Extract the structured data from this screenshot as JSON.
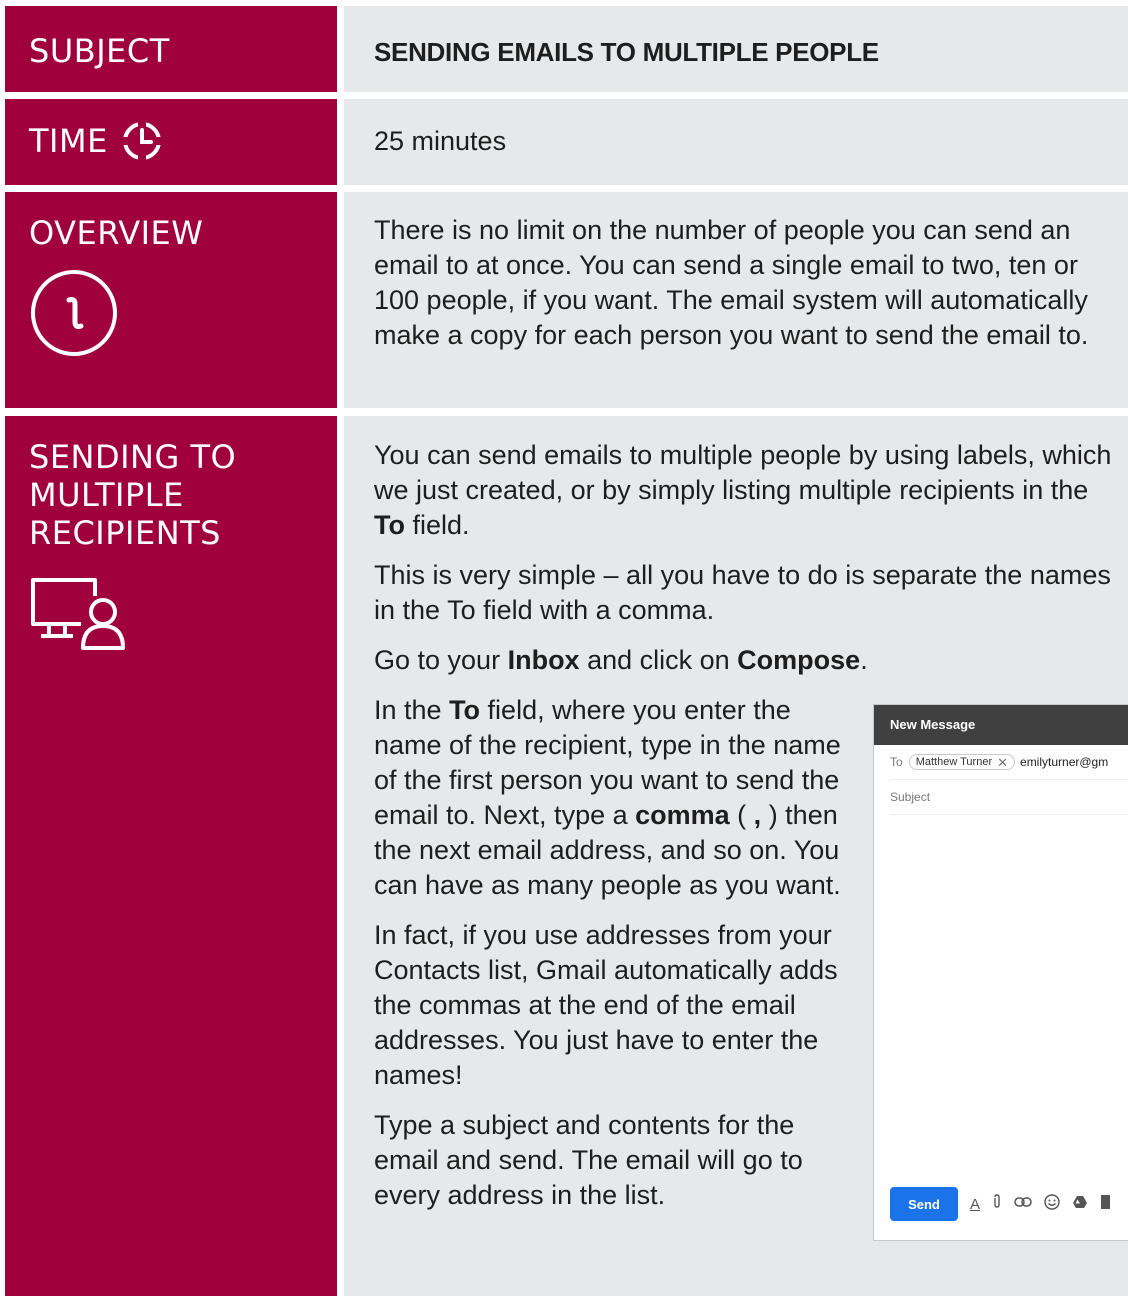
{
  "rows": {
    "subject": {
      "label": "SUBJECT",
      "value": "SENDING EMAILS TO MULTIPLE PEOPLE"
    },
    "time": {
      "label": "TIME",
      "icon": "clock-icon",
      "value": "25 minutes"
    },
    "overview": {
      "label": "OVERVIEW",
      "icon": "info-icon",
      "text": "There is no limit on the number of people you can send an email to at once. You can send a single email to two, ten or 100 people, if you want. The email system will automatically make a copy for each person you want to send the email to."
    },
    "sending": {
      "label_lines": [
        "SENDING TO",
        "MULTIPLE",
        "RECIPIENTS"
      ],
      "icon": "computer-person-icon",
      "p1_a": "You can send emails to multiple people by using labels, which we just created, or by simply listing multiple recipients in the ",
      "p1_b": "To",
      "p1_c": " field.",
      "p2": "This is very simple – all you have to do is separate the names in the To field with a comma.",
      "p3_a": "Go to your ",
      "p3_b": "Inbox",
      "p3_c": " and click on ",
      "p3_d": "Compose",
      "p3_e": ".",
      "p4_a": "In the ",
      "p4_b": "To",
      "p4_c": " field, where you enter the name of the recipient, type in the name of the first person you want to send the email to. Next, type a ",
      "p4_d": "comma",
      "p4_e": " ( ",
      "p4_f": ",",
      "p4_g": " ) then the next email address, and so on. You can have as many people as you want.",
      "p5": "In fact, if you use addresses from your Contacts list, Gmail automatically adds the commas at the end of the email addresses. You just have to enter the names!",
      "p6": "Type a subject and contents for the email and send. The email will go to every address in the list."
    }
  },
  "compose": {
    "title": "New Message",
    "to_label": "To",
    "chip_name": "Matthew Turner",
    "chip_close": "✕",
    "typed": "emilyturner@gm",
    "subject_placeholder": "Subject",
    "send_label": "Send",
    "tools": [
      "format-text-icon",
      "attach-icon",
      "link-icon",
      "emoji-icon",
      "drive-icon",
      "photo-icon"
    ]
  },
  "colors": {
    "label_bg": "#a0003c",
    "content_bg": "#e7e8e9",
    "send_blue": "#1a73e8"
  }
}
